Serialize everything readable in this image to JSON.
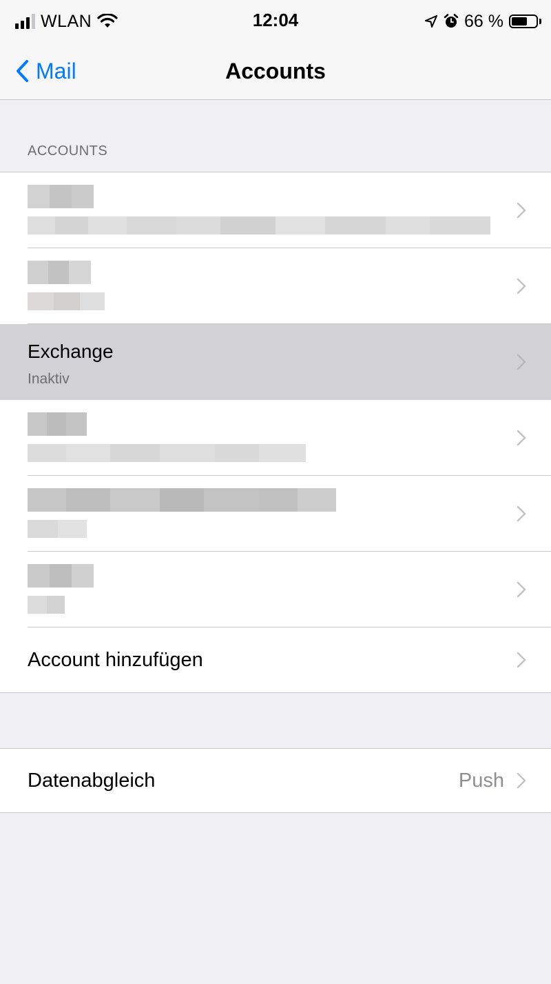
{
  "status_bar": {
    "carrier": "WLAN",
    "time": "12:04",
    "battery_text": "66 %",
    "battery_level": 0.66,
    "icons": [
      "signal-icon",
      "wifi-icon",
      "location-icon",
      "alarm-icon",
      "battery-icon"
    ]
  },
  "nav": {
    "back_label": "Mail",
    "title": "Accounts"
  },
  "accounts_section": {
    "header": "ACCOUNTS",
    "exchange": {
      "title": "Exchange",
      "subtitle": "Inaktiv"
    },
    "add_account": "Account hinzufügen"
  },
  "sync": {
    "label": "Datenabgleich",
    "value": "Push"
  },
  "colors": {
    "accent": "#007aff",
    "background": "#efeff4",
    "selected_row": "#d1d1d6",
    "secondary_text": "#6d6d72"
  }
}
